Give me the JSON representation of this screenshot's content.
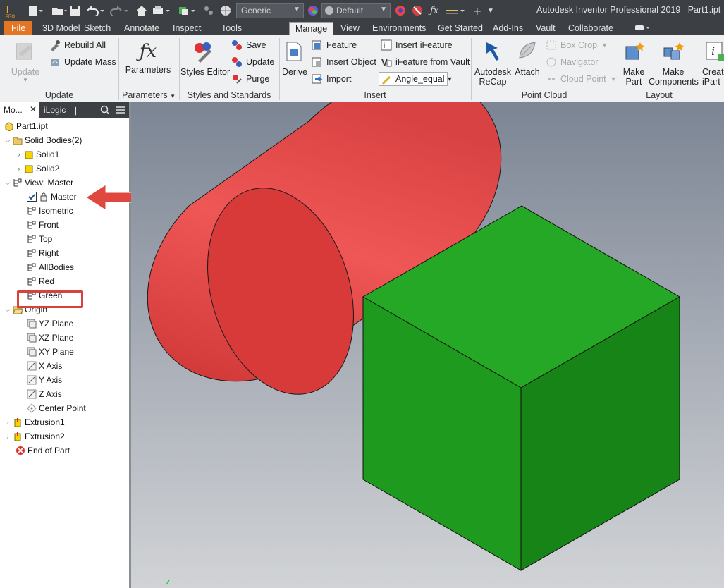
{
  "titlebar": {
    "app_title": "Autodesk Inventor Professional 2019",
    "file_name": "Part1.ipt",
    "material_combo": "Generic",
    "appearance_combo": "Default"
  },
  "menu_tabs": [
    "File",
    "3D Model",
    "Sketch",
    "Annotate",
    "Inspect",
    "Tools",
    "Manage",
    "View",
    "Environments",
    "Get Started",
    "Add-Ins",
    "Vault",
    "Collaborate"
  ],
  "active_tab": "Manage",
  "ribbon": {
    "update_panel": {
      "label": "Update",
      "update": "Update",
      "rebuild_all": "Rebuild All",
      "update_mass": "Update Mass"
    },
    "parameters_panel": {
      "label": "Parameters",
      "parameters": "Parameters"
    },
    "styles_panel": {
      "label": "Styles and Standards",
      "styles_editor": "Styles Editor",
      "save": "Save",
      "update": "Update",
      "purge": "Purge"
    },
    "insert_panel": {
      "label": "Insert",
      "derive": "Derive",
      "feature": "Feature",
      "insert_object": "Insert Object",
      "import": "Import",
      "insert_ifeature": "Insert iFeature",
      "ifeature_from_vault": "iFeature from Vault",
      "angle_combo": "Angle_equal"
    },
    "point_cloud_panel": {
      "label": "Point Cloud",
      "autodesk": "Autodesk",
      "recap": "ReCap",
      "attach": "Attach",
      "box_crop": "Box Crop",
      "navigator": "Navigator",
      "cloud_point": "Cloud Point"
    },
    "layout_panel": {
      "label": "Layout",
      "make": "Make",
      "part": "Part",
      "make2": "Make",
      "components": "Components",
      "create": "Creat",
      "ipart": "iPart"
    }
  },
  "browser": {
    "tab_model": "Mo...",
    "tab_ilogic": "iLogic",
    "items": [
      {
        "label": "Part1.ipt"
      },
      {
        "label": "Solid Bodies(2)"
      },
      {
        "label": "Solid1"
      },
      {
        "label": "Solid2"
      },
      {
        "label": "View: Master"
      },
      {
        "label": "Master"
      },
      {
        "label": "Isometric"
      },
      {
        "label": "Front"
      },
      {
        "label": "Top"
      },
      {
        "label": "Right"
      },
      {
        "label": "AllBodies"
      },
      {
        "label": "Red"
      },
      {
        "label": "Green"
      },
      {
        "label": "Origin"
      },
      {
        "label": "YZ Plane"
      },
      {
        "label": "XZ Plane"
      },
      {
        "label": "XY Plane"
      },
      {
        "label": "X Axis"
      },
      {
        "label": "Y Axis"
      },
      {
        "label": "Z Axis"
      },
      {
        "label": "Center Point"
      },
      {
        "label": "Extrusion1"
      },
      {
        "label": "Extrusion2"
      },
      {
        "label": "End of Part"
      }
    ]
  },
  "colors": {
    "cylinder": "#e84848",
    "cube_front": "#1e9a1e",
    "cube_top": "#25a825",
    "cube_side": "#178417",
    "callout": "#d9423b",
    "file_tab": "#e37625"
  }
}
